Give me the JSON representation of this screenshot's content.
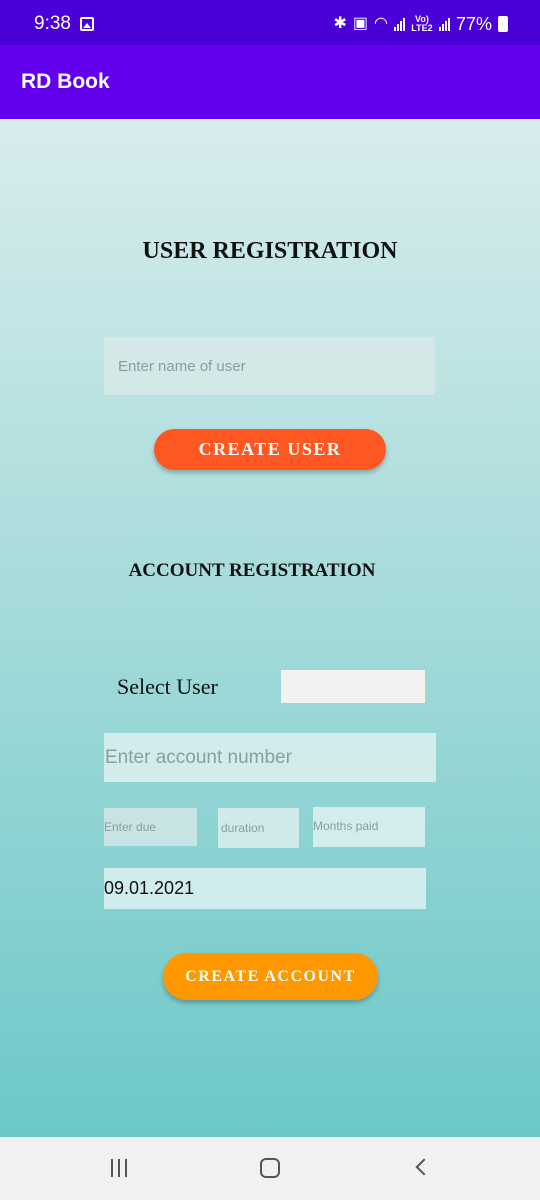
{
  "status_bar": {
    "time": "9:38",
    "battery": "77%",
    "network_label": "Vo) LTE2"
  },
  "app_bar": {
    "title": "RD Book"
  },
  "user_registration": {
    "heading": "USER REGISTRATION",
    "name_placeholder": "Enter name of user",
    "create_user_label": "CREATE USER"
  },
  "account_registration": {
    "heading": "ACCOUNT REGISTRATION",
    "select_user_label": "Select User",
    "selected_user": "",
    "account_number_placeholder": "Enter account number",
    "due_placeholder": "Enter due",
    "duration_placeholder": "duration",
    "months_paid_placeholder": "Months paid",
    "date_value": "09.01.2021",
    "create_account_label": "CREATE ACCOUNT"
  },
  "colors": {
    "status_bar": "#4a00d6",
    "app_bar": "#6200ee",
    "create_user_button": "#ff5722",
    "create_account_button": "#ff9800",
    "background_top": "#d8eced",
    "background_bottom": "#6cc8c8"
  },
  "icons": {
    "status": [
      "image-icon",
      "bluetooth-icon",
      "alarm-icon",
      "wifi-icon",
      "signal-icon",
      "battery-icon"
    ],
    "navigation": [
      "recents-icon",
      "home-icon",
      "back-icon"
    ]
  }
}
